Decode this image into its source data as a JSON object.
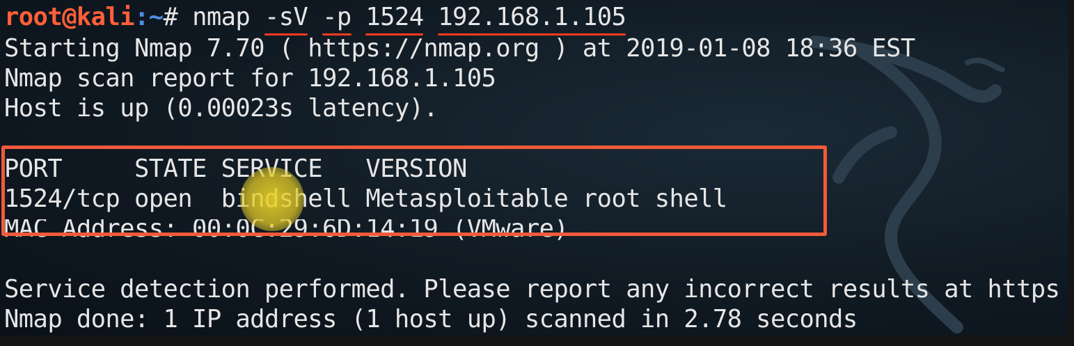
{
  "terminal": {
    "prompt_user": "root@kali",
    "prompt_path": ":~",
    "prompt_symbol": "# ",
    "command_name": "nmap",
    "command_flag_sv": "-sV",
    "command_flag_p": "-p",
    "command_port": "1524",
    "command_host": "192.168.1.105",
    "lines": [
      "Starting Nmap 7.70 ( https://nmap.org ) at 2019-01-08 18:36 EST",
      "Nmap scan report for 192.168.1.105",
      "Host is up (0.00023s latency).",
      "PORT     STATE SERVICE   VERSION",
      "1524/tcp open  bindshell Metasploitable root shell",
      "MAC Address: 00:0C:29:6D:14:19 (VMware)",
      "Service detection performed. Please report any incorrect results at https",
      "Nmap done: 1 IP address (1 host up) scanned in 2.78 seconds"
    ]
  },
  "colors": {
    "prompt_user": "#ff5f3a",
    "prompt_path": "#4f8fe6",
    "annotation": "#f25a3a",
    "text": "#e6e6e6",
    "cursor_highlight": "#e8cf2a"
  },
  "icons": {
    "background": "kali-dragon-logo"
  }
}
